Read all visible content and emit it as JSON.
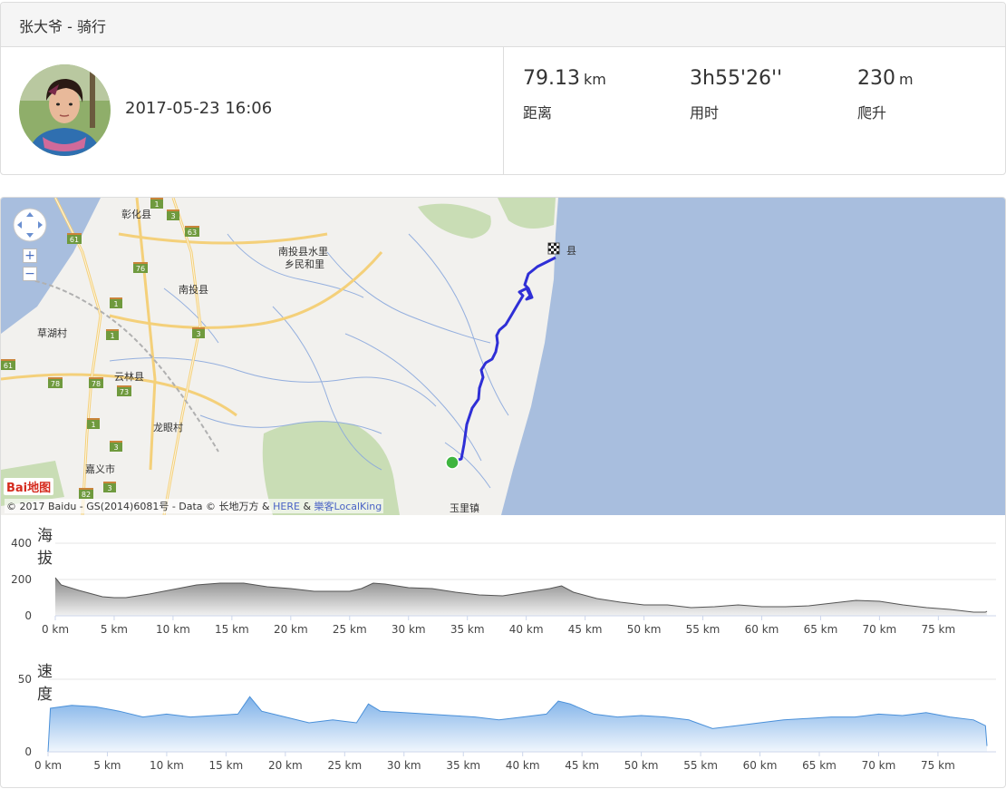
{
  "header": {
    "title": "张大爷 - 骑行"
  },
  "activity": {
    "datetime": "2017-05-23 16:06"
  },
  "stats": [
    {
      "value": "79.13",
      "unit": "km",
      "label": "距离"
    },
    {
      "value": "3h55'26''",
      "unit": "",
      "label": "用时"
    },
    {
      "value": "230",
      "unit": "m",
      "label": "爬升"
    }
  ],
  "map": {
    "labels": [
      "彰化县",
      "南投县水里",
      "乡民和里",
      "南投县",
      "草湖村",
      "云林县",
      "龙眼村",
      "嘉义市",
      "玉里镇",
      "县"
    ],
    "road_shields": [
      "1",
      "3",
      "63",
      "61",
      "76",
      "1",
      "1",
      "3",
      "61",
      "78",
      "78",
      "73",
      "1",
      "3",
      "3",
      "82"
    ],
    "attribution": {
      "text": "© 2017 Baidu - GS(2014)6081号 - Data © 长地万方 &",
      "link1": "HERE",
      "amp": "&",
      "link2": "樂客LocalKing"
    },
    "logo": "Bai地图",
    "zoom_in": "+",
    "zoom_out": "−",
    "colors": {
      "sea": "#a8bede",
      "land": "#f2f1ee",
      "forest": "#c9ddb5",
      "route": "#2f2fd6",
      "highway": "#f4d07a",
      "river": "#8aa8dd"
    }
  },
  "chart_data": [
    {
      "type": "area",
      "title": "海拔",
      "xlabel": "km",
      "ylabel": "",
      "xlim": [
        0,
        79.13
      ],
      "ylim": [
        0,
        400
      ],
      "yticks": [
        0,
        200,
        400
      ],
      "xticks": [
        "0 km",
        "5 km",
        "10 km",
        "15 km",
        "20 km",
        "25 km",
        "30 km",
        "35 km",
        "40 km",
        "45 km",
        "50 km",
        "55 km",
        "60 km",
        "65 km",
        "70 km",
        "75 km"
      ],
      "grid": true,
      "color": "#7a7a7a",
      "x": [
        0,
        0.5,
        2,
        4,
        5,
        6,
        8,
        10,
        12,
        14,
        16,
        18,
        20,
        22,
        24,
        25,
        26,
        27,
        28,
        30,
        32,
        34,
        36,
        38,
        40,
        42,
        43,
        44,
        46,
        48,
        50,
        52,
        54,
        56,
        58,
        60,
        62,
        64,
        66,
        68,
        70,
        72,
        74,
        76,
        78,
        79,
        79.13
      ],
      "y": [
        210,
        170,
        140,
        105,
        100,
        100,
        120,
        145,
        170,
        180,
        180,
        160,
        150,
        135,
        135,
        135,
        150,
        180,
        175,
        155,
        150,
        130,
        115,
        110,
        130,
        150,
        165,
        130,
        95,
        75,
        60,
        60,
        45,
        50,
        60,
        50,
        50,
        55,
        70,
        85,
        80,
        60,
        45,
        35,
        20,
        20,
        25
      ]
    },
    {
      "type": "area",
      "title": "速度",
      "xlabel": "km",
      "ylabel": "",
      "xlim": [
        0,
        79.13
      ],
      "ylim": [
        0,
        50
      ],
      "yticks": [
        0,
        50
      ],
      "xticks": [
        "0 km",
        "5 km",
        "10 km",
        "15 km",
        "20 km",
        "25 km",
        "30 km",
        "35 km",
        "40 km",
        "45 km",
        "50 km",
        "55 km",
        "60 km",
        "65 km",
        "70 km",
        "75 km"
      ],
      "grid": true,
      "color": "#6fa8e6",
      "x": [
        0,
        0.2,
        2,
        4,
        6,
        8,
        10,
        12,
        14,
        16,
        17,
        18,
        20,
        22,
        24,
        26,
        27,
        28,
        30,
        32,
        34,
        36,
        38,
        40,
        42,
        43,
        44,
        46,
        48,
        50,
        52,
        54,
        56,
        58,
        60,
        62,
        64,
        66,
        68,
        70,
        72,
        74,
        76,
        78,
        79,
        79.13
      ],
      "y": [
        0,
        30,
        32,
        31,
        28,
        24,
        26,
        24,
        25,
        26,
        38,
        28,
        24,
        20,
        22,
        20,
        33,
        28,
        27,
        26,
        25,
        24,
        22,
        24,
        26,
        35,
        33,
        26,
        24,
        25,
        24,
        22,
        16,
        18,
        20,
        22,
        23,
        24,
        24,
        26,
        25,
        27,
        24,
        22,
        18,
        4
      ]
    }
  ]
}
